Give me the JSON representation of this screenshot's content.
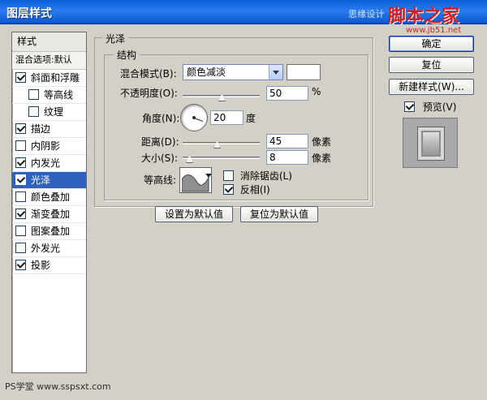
{
  "window": {
    "title": "图层样式",
    "watermark_left": "思缘设计",
    "watermark_logo": "脚本之家",
    "watermark_url": "www.jb51.net",
    "footer_watermark": "PS学堂 www.sspsxt.com"
  },
  "left_panel": {
    "header": "样式",
    "subheader": "混合选项:默认",
    "items": [
      {
        "label": "斜面和浮雕",
        "checked": true,
        "sub": false
      },
      {
        "label": "等高线",
        "checked": false,
        "sub": true
      },
      {
        "label": "纹理",
        "checked": false,
        "sub": true
      },
      {
        "label": "描边",
        "checked": true,
        "sub": false
      },
      {
        "label": "内阴影",
        "checked": false,
        "sub": false
      },
      {
        "label": "内发光",
        "checked": true,
        "sub": false
      },
      {
        "label": "光泽",
        "checked": true,
        "sub": false,
        "selected": true
      },
      {
        "label": "颜色叠加",
        "checked": false,
        "sub": false
      },
      {
        "label": "渐变叠加",
        "checked": true,
        "sub": false
      },
      {
        "label": "图案叠加",
        "checked": false,
        "sub": false
      },
      {
        "label": "外发光",
        "checked": false,
        "sub": false
      },
      {
        "label": "投影",
        "checked": true,
        "sub": false
      }
    ]
  },
  "main": {
    "section_title": "光泽",
    "structure_title": "结构",
    "blend_mode_label": "混合模式(B):",
    "blend_mode_value": "颜色减淡",
    "opacity_label": "不透明度(O):",
    "opacity_value": "50",
    "opacity_unit": "%",
    "angle_label": "角度(N):",
    "angle_value": "20",
    "angle_unit": "度",
    "distance_label": "距离(D):",
    "distance_value": "45",
    "distance_unit": "像素",
    "size_label": "大小(S):",
    "size_value": "8",
    "size_unit": "像素",
    "contour_label": "等高线:",
    "anti_alias_label": "消除锯齿(L)",
    "invert_label": "反相(I)",
    "anti_alias_checked": false,
    "invert_checked": true,
    "set_default_button": "设置为默认值",
    "reset_default_button": "复位为默认值"
  },
  "right_panel": {
    "ok_button": "确定",
    "reset_button": "复位",
    "new_style_button": "新建样式(W)...",
    "preview_label": "预览(V)",
    "preview_checked": true
  },
  "colors": {
    "accent_blue": "#2f62bf",
    "titlebar_blue": "#0a5fd8",
    "watermark_red": "#d51f1f"
  }
}
